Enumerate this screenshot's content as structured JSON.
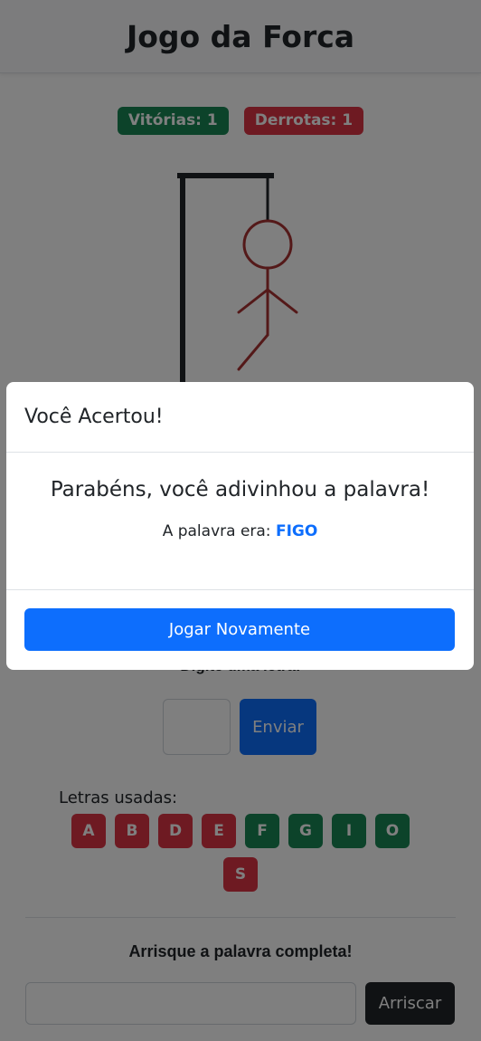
{
  "app": {
    "title": "Jogo da Forca"
  },
  "scores": {
    "wins": "Vitórias: 1",
    "losses": "Derrotas: 1"
  },
  "colors": {
    "primary": "#0d6efd",
    "success": "#198754",
    "danger": "#dc3545",
    "dark": "#212529",
    "hangman": "#a83232"
  },
  "icons": {
    "gallows": "gallows-drawing",
    "hangman": "hangman-figure"
  },
  "letter_form": {
    "label": "Digite uma letra:",
    "input_value": "",
    "submit_label": "Enviar"
  },
  "used_letters": {
    "title": "Letras usadas:",
    "letters": [
      {
        "letter": "A",
        "status": "wrong"
      },
      {
        "letter": "B",
        "status": "wrong"
      },
      {
        "letter": "D",
        "status": "wrong"
      },
      {
        "letter": "E",
        "status": "wrong"
      },
      {
        "letter": "F",
        "status": "right"
      },
      {
        "letter": "G",
        "status": "right"
      },
      {
        "letter": "I",
        "status": "right"
      },
      {
        "letter": "O",
        "status": "right"
      },
      {
        "letter": "S",
        "status": "wrong"
      }
    ]
  },
  "word_form": {
    "label": "Arrisque a palavra completa!",
    "input_value": "",
    "submit_label": "Arriscar"
  },
  "modal": {
    "title": "Você Acertou!",
    "message": "Parabéns, você adivinhou a palavra!",
    "word_prefix": "A palavra era:",
    "word": "FIGO",
    "button_label": "Jogar Novamente"
  }
}
